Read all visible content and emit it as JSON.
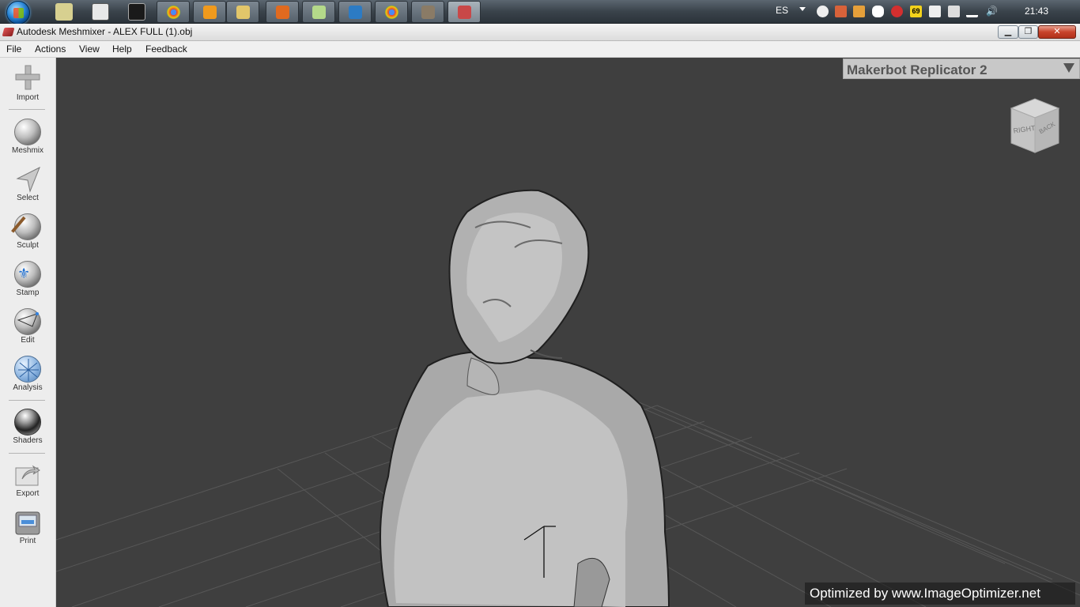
{
  "taskbar": {
    "language": "ES",
    "clock": "21:43",
    "tray_badge": "69",
    "colors": {
      "start": "#2a86d6",
      "button": "#5c6770"
    }
  },
  "window": {
    "title": "Autodesk Meshmixer - ALEX FULL (1).obj",
    "minimize": "▁",
    "maximize": "❐",
    "close": "✕"
  },
  "menu": [
    "File",
    "Actions",
    "View",
    "Help",
    "Feedback"
  ],
  "tools": [
    {
      "label": "Import",
      "icon": "plus-icon"
    },
    {
      "label": "Meshmix",
      "icon": "face-sphere-icon"
    },
    {
      "label": "Select",
      "icon": "arrow-pointer-icon"
    },
    {
      "label": "Sculpt",
      "icon": "brush-sphere-icon"
    },
    {
      "label": "Stamp",
      "icon": "stamp-sphere-icon"
    },
    {
      "label": "Edit",
      "icon": "edit-sphere-icon"
    },
    {
      "label": "Analysis",
      "icon": "mesh-sphere-icon"
    },
    {
      "label": "Shaders",
      "icon": "chrome-sphere-icon"
    },
    {
      "label": "Export",
      "icon": "export-icon"
    },
    {
      "label": "Print",
      "icon": "printer-icon"
    }
  ],
  "viewport": {
    "printer": "Makerbot Replicator 2",
    "viewcube": {
      "right": "RIGHT",
      "back": "BACK"
    },
    "watermark": "Optimized by www.ImageOptimizer.net",
    "colors": {
      "background": "#3f3f3f",
      "model": "#bdbdbd",
      "grid": "#5a5a5a"
    }
  }
}
